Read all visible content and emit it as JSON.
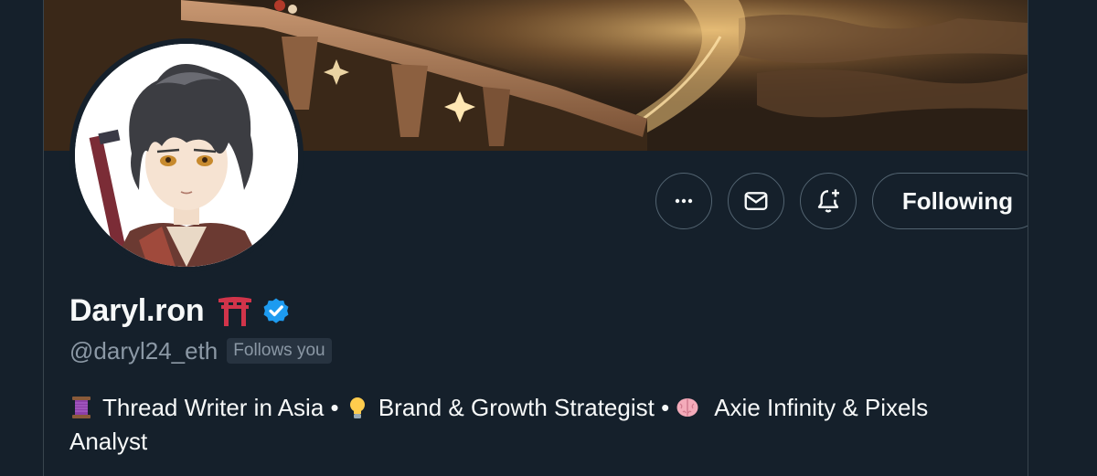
{
  "profile": {
    "display_name": "Daryl.ron",
    "name_emoji": "torii-gate",
    "verified": true,
    "handle": "@daryl24_eth",
    "follows_you": "Follows you",
    "bio": {
      "segments": [
        {
          "icon": "thread-spool",
          "text": "Thread Writer in Asia • "
        },
        {
          "icon": "light-bulb",
          "text": "Brand & Growth Strategist • "
        },
        {
          "icon": "brain",
          "text": " Axie Infinity & Pixels Analyst"
        }
      ]
    }
  },
  "actions": {
    "following_label": "Following"
  },
  "colors": {
    "background": "#15202b",
    "text_primary": "#f7f9f9",
    "text_secondary": "#8b98a5",
    "border": "#536471",
    "verified_blue": "#1d9bf0"
  }
}
